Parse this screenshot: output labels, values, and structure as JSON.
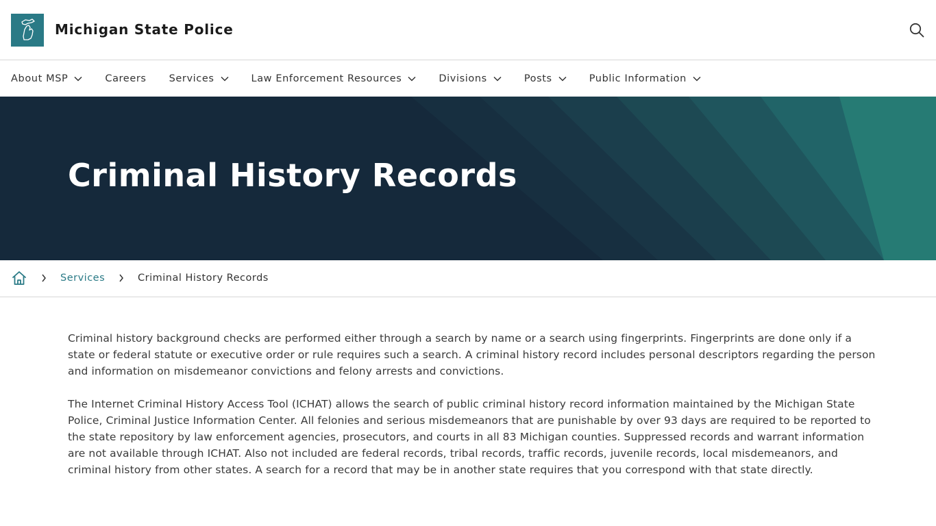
{
  "header": {
    "site_title": "Michigan State Police",
    "logo_icon": "michigan-map-icon",
    "search_icon": "search-icon"
  },
  "nav": {
    "items": [
      {
        "label": "About MSP",
        "has_dropdown": true
      },
      {
        "label": "Careers",
        "has_dropdown": false
      },
      {
        "label": "Services",
        "has_dropdown": true
      },
      {
        "label": "Law Enforcement Resources",
        "has_dropdown": true
      },
      {
        "label": "Divisions",
        "has_dropdown": true
      },
      {
        "label": "Posts",
        "has_dropdown": true
      },
      {
        "label": "Public Information",
        "has_dropdown": true
      }
    ]
  },
  "hero": {
    "title": "Criminal History Records"
  },
  "breadcrumb": {
    "home_icon": "home-icon",
    "link": "Services",
    "current": "Criminal History Records"
  },
  "content": {
    "paragraphs": [
      "Criminal history background checks are performed either through a search by name or a search using fingerprints. Fingerprints are done only if a state or federal statute or executive order or rule requires such a search. A criminal history record includes personal descriptors regarding the person and information on misdemeanor convictions and felony arrests and convictions.",
      "The Internet Criminal History Access Tool (ICHAT) allows the search of public criminal history record information maintained by the Michigan State Police, Criminal Justice Information Center. All felonies and serious misdemeanors that are punishable by over 93 days are required to be reported to the state repository by law enforcement agencies, prosecutors, and courts in all 83 Michigan counties. Suppressed records and warrant information are not available through ICHAT. Also not included are federal records, tribal records, traffic records, juvenile records, local misdemeanors, and criminal history from other states. A search for a record that may be in another state requires that you correspond with that state directly."
    ]
  },
  "colors": {
    "brand_teal": "#2a7a86",
    "hero_dark": "#15293b",
    "link": "#2a7a86"
  }
}
